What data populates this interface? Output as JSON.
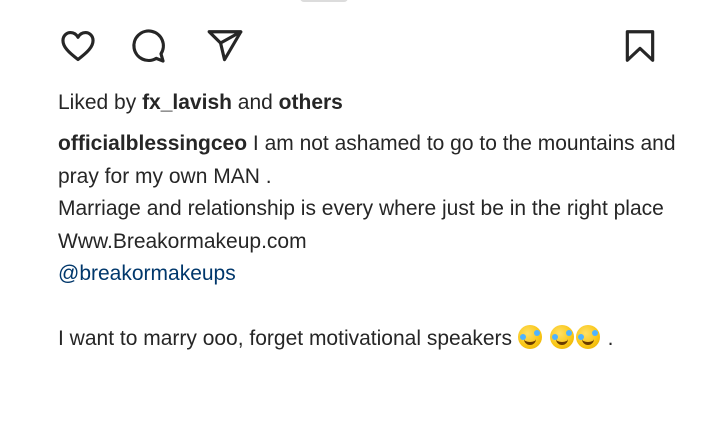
{
  "icons": {
    "like": "heart-icon",
    "comment": "comment-icon",
    "share": "paper-plane-icon",
    "save": "bookmark-icon"
  },
  "likes": {
    "prefix": "Liked by ",
    "user": "fx_lavish",
    "middle": " and ",
    "others": "others"
  },
  "caption": {
    "username": "officialblessingceo",
    "line1": " I am not ashamed to go to the mountains and pray for my own MAN .",
    "line2": "Marriage and relationship is every where just be in the right place",
    "line3": "Www.Breakormakeup.com",
    "mention": "@breakormakeups",
    "line4": "I want to marry ooo, forget motivational speakers ",
    "emoji": "rolling-on-floor-laughing-emoji",
    "end": " ."
  },
  "colors": {
    "text": "#262626",
    "mention": "#00376b"
  }
}
